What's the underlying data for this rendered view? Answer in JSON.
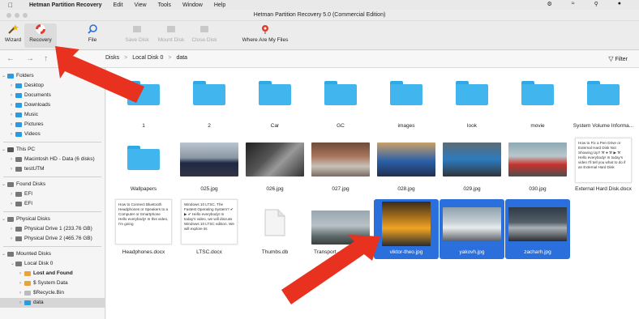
{
  "menubar": {
    "apple": "",
    "app_name": "Hetman Partition Recovery",
    "items": [
      "Edit",
      "View",
      "Tools",
      "Window",
      "Help"
    ]
  },
  "window": {
    "title": "Hetman Partition Recovery 5.0 (Commercial Edition)"
  },
  "toolbar": {
    "wizard": "Wizard",
    "recovery": "Recovery",
    "file": "File",
    "save_disk": "Save Disk",
    "mount_disk": "Mount Disk",
    "close_disk": "Close Disk",
    "where_are_my_files": "Where Are My Files"
  },
  "breadcrumb": {
    "items": [
      "Disks",
      "Local Disk 0",
      "data"
    ],
    "separator": ">"
  },
  "filter_label": "Filter",
  "sidebar": {
    "folders_header": "Folders",
    "folders": [
      "Desktop",
      "Documents",
      "Downloads",
      "Music",
      "Pictures",
      "Videos"
    ],
    "this_pc_header": "This PC",
    "this_pc": [
      "Macintosh HD - Data (6 disks)",
      "testUTM"
    ],
    "found_header": "Found Disks",
    "found": [
      "EFI",
      "EFI"
    ],
    "physical_header": "Physical Disks",
    "physical": [
      "Physical Drive 1 (233.76 GB)",
      "Physical Drive 2 (465.76 GB)"
    ],
    "mounted_header": "Mounted Disks",
    "mounted_disk": "Local Disk 0",
    "mounted_children": [
      "Lost and Found",
      "$ System Data",
      "$Recycle.Bin",
      "data"
    ]
  },
  "files_row1": [
    "1",
    "2",
    "Car",
    "GC",
    "images",
    "look",
    "movie",
    "System Volume Informa..."
  ],
  "files_row2": [
    "Wallpapers",
    "025.jpg",
    "026.jpg",
    "027.jpg",
    "028.jpg",
    "029.jpg",
    "030.jpg",
    "External Hard Disk.docx"
  ],
  "files_row3": [
    "Headphones.docx",
    "LTSC.docx",
    "Thumbs.db",
    "Transport - 23232.mp4",
    "viktor-theo.jpg",
    "yakovh.jpg",
    "zacharh.jpg"
  ],
  "doc_previews": {
    "external": "How to Fix a Pen Drive or External Hard Disk Not Showing Up? ⚒ ● ⚒ ▶ ⚒ Hello everybody! In today's video I'll tell you what to do if an External Hard Disk",
    "headphones": "How to Connect Bluetooth Headphones or Speakers to a Computer or Smartphone  Hello everybody! In this video, I'm going",
    "ltsc": "Windows 10 LTSC. The Fastest Operating System? ✔ ▶ ✔ Hello everybody! In today's video, we will discuss Windows 10 LTSC edition. We will explore its"
  }
}
